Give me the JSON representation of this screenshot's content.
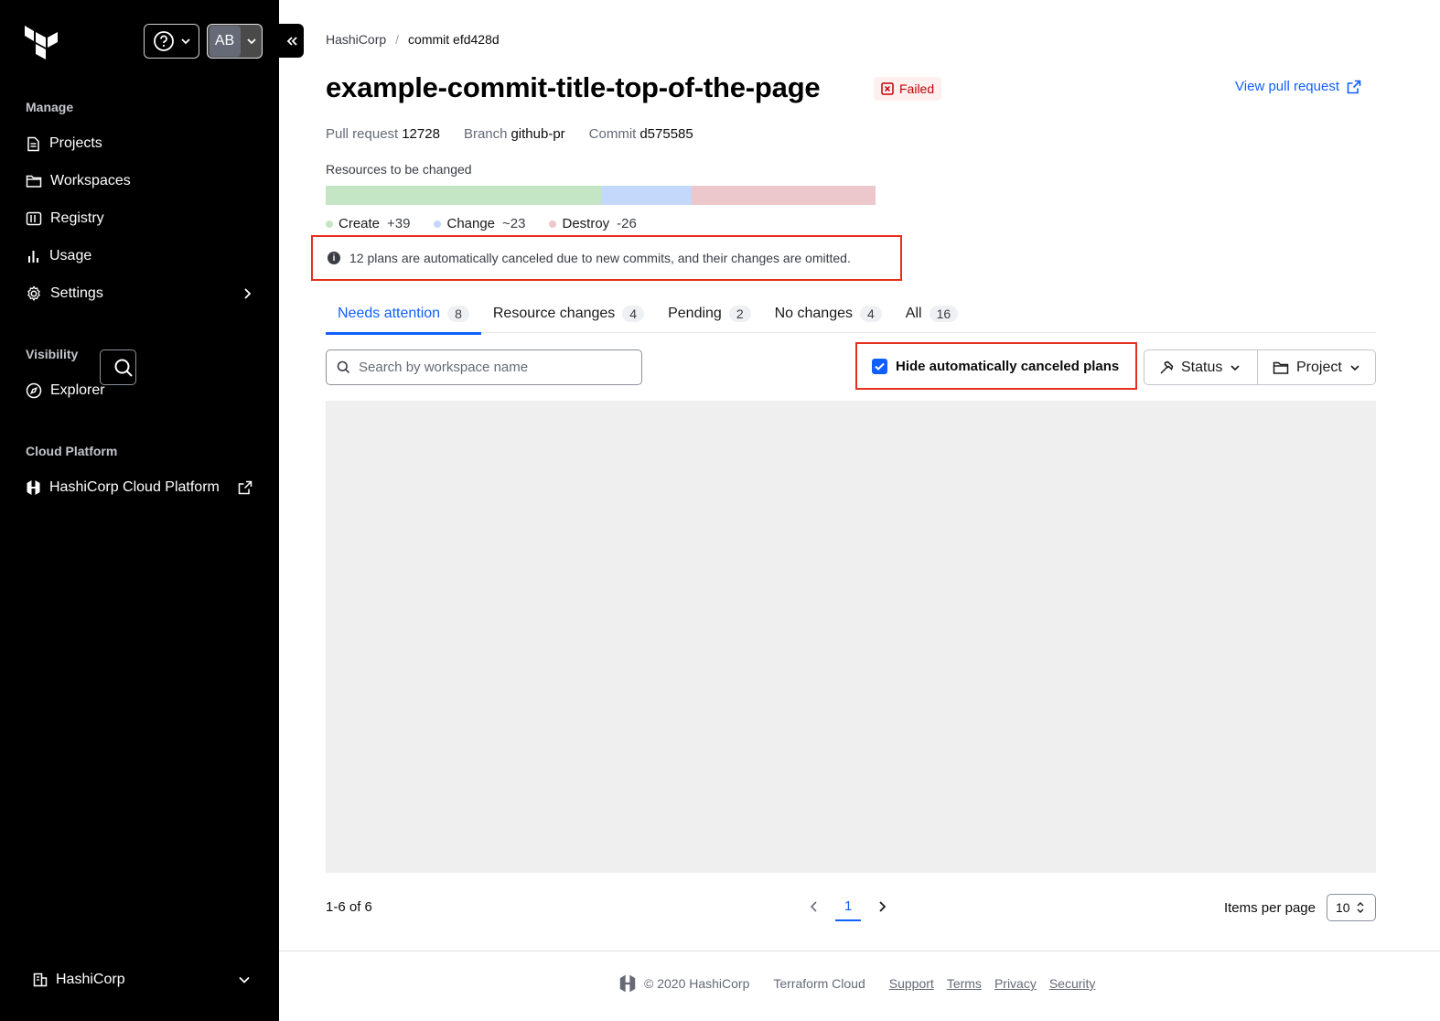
{
  "sidebar": {
    "sections": {
      "manage": "Manage",
      "visibility": "Visibility",
      "cloud_platform": "Cloud Platform"
    },
    "user_initials": "AB",
    "items": {
      "projects": "Projects",
      "workspaces": "Workspaces",
      "registry": "Registry",
      "usage": "Usage",
      "settings": "Settings",
      "explorer": "Explorer",
      "hcp": "HashiCorp Cloud Platform"
    },
    "org_name": "HashiCorp"
  },
  "breadcrumb": {
    "org": "HashiCorp",
    "separator": "/",
    "current": "commit efd428d"
  },
  "page": {
    "title": "example-commit-title-top-of-the-page",
    "status_badge": "Failed",
    "view_pr": "View pull request"
  },
  "meta": {
    "pr_label": "Pull request",
    "pr_value": "12728",
    "branch_label": "Branch",
    "branch_value": "github-pr",
    "commit_label": "Commit",
    "commit_value": "d575585"
  },
  "resources": {
    "label": "Resources to be changed",
    "create_label": "Create",
    "create_value": "+39",
    "change_label": "Change",
    "change_value": "~23",
    "destroy_label": "Destroy",
    "destroy_value": "-26",
    "bar_fractions": {
      "create": 0.5,
      "change": 0.166,
      "destroy": 0.334
    },
    "colors": {
      "create": "#c5e6c5",
      "change": "#c3d8fb",
      "destroy": "#ecc7cb"
    }
  },
  "notice": "12 plans are automatically canceled due to new commits, and their changes are omitted.",
  "tabs": [
    {
      "label": "Needs attention",
      "count": "8"
    },
    {
      "label": "Resource changes",
      "count": "4"
    },
    {
      "label": "Pending",
      "count": "2"
    },
    {
      "label": "No changes",
      "count": "4"
    },
    {
      "label": "All",
      "count": "16"
    }
  ],
  "filters": {
    "search_placeholder": "Search by workspace name",
    "hide_canceled_label": "Hide automatically canceled plans",
    "hide_canceled_checked": true,
    "status_label": "Status",
    "project_label": "Project"
  },
  "pagination": {
    "range": "1-6 of 6",
    "current_page": "1",
    "items_per_page_label": "Items per page",
    "items_per_page_value": "10"
  },
  "footer": {
    "copyright": "© 2020 HashiCorp",
    "product": "Terraform Cloud",
    "support": "Support",
    "terms": "Terms",
    "privacy": "Privacy",
    "security": "Security"
  },
  "colors": {
    "accent": "#1060ff",
    "highlight_border": "#e5301f",
    "failed": "#c00005"
  }
}
